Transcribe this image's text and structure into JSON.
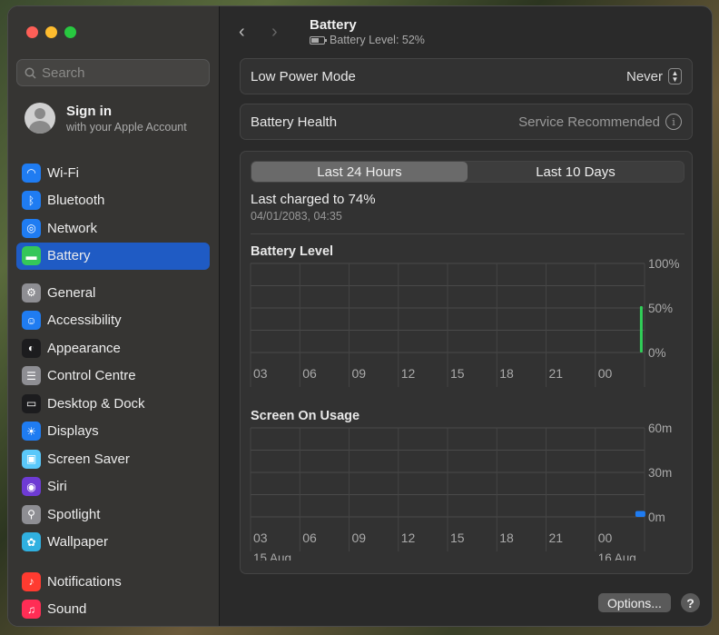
{
  "window": {
    "traffic": {
      "close": "#fe5f57",
      "minimize": "#febc2e",
      "zoom": "#28c840"
    }
  },
  "sidebar": {
    "search_placeholder": "Search",
    "account": {
      "title": "Sign in",
      "subtitle": "with your Apple Account"
    },
    "groups": [
      [
        {
          "label": "Wi-Fi",
          "icon": "wifi-icon",
          "color": "#1f7cf2"
        },
        {
          "label": "Bluetooth",
          "icon": "bluetooth-icon",
          "color": "#1f7cf2"
        },
        {
          "label": "Network",
          "icon": "globe-icon",
          "color": "#1f7cf2"
        },
        {
          "label": "Battery",
          "icon": "battery-icon",
          "color": "#34c759",
          "active": true
        }
      ],
      [
        {
          "label": "General",
          "icon": "gear-icon",
          "color": "#8e8e93"
        },
        {
          "label": "Accessibility",
          "icon": "accessibility-icon",
          "color": "#1f7cf2"
        },
        {
          "label": "Appearance",
          "icon": "appearance-icon",
          "color": "#1c1c1e"
        },
        {
          "label": "Control Centre",
          "icon": "control-centre-icon",
          "color": "#8e8e93"
        },
        {
          "label": "Desktop & Dock",
          "icon": "dock-icon",
          "color": "#1c1c1e"
        },
        {
          "label": "Displays",
          "icon": "sun-icon",
          "color": "#1f7cf2"
        },
        {
          "label": "Screen Saver",
          "icon": "screen-saver-icon",
          "color": "#5ac8fa"
        },
        {
          "label": "Siri",
          "icon": "siri-icon",
          "color": "#6e3bd4"
        },
        {
          "label": "Spotlight",
          "icon": "magnifier-icon",
          "color": "#8e8e93"
        },
        {
          "label": "Wallpaper",
          "icon": "wallpaper-icon",
          "color": "#30b0e0"
        }
      ],
      [
        {
          "label": "Notifications",
          "icon": "bell-icon",
          "color": "#ff3b30"
        },
        {
          "label": "Sound",
          "icon": "speaker-icon",
          "color": "#ff2d55"
        }
      ]
    ]
  },
  "header": {
    "title": "Battery",
    "subtitle": "Battery Level: 52%",
    "level": 0.52
  },
  "low_power": {
    "label": "Low Power Mode",
    "value": "Never"
  },
  "health": {
    "label": "Battery Health",
    "value": "Service Recommended"
  },
  "usage": {
    "tabs": [
      "Last 24 Hours",
      "Last 10 Days"
    ],
    "selected_tab": 0,
    "charged": "Last charged to 74%",
    "charged_date": "04/01/2083, 04:35"
  },
  "chart_data": [
    {
      "type": "bar",
      "title": "Battery Level",
      "x_ticks": [
        "03",
        "06",
        "09",
        "12",
        "15",
        "18",
        "21",
        "00"
      ],
      "y_ticks": [
        "100%",
        "50%",
        "0%"
      ],
      "ylim": [
        0,
        100
      ],
      "bars": [
        {
          "hour_offset": 23.8,
          "value": 52
        }
      ],
      "color": "#30d158"
    },
    {
      "type": "bar",
      "title": "Screen On Usage",
      "x_ticks": [
        "03",
        "06",
        "09",
        "12",
        "15",
        "18",
        "21",
        "00"
      ],
      "y_ticks": [
        "60m",
        "30m",
        "0m"
      ],
      "date_labels": [
        "15 Aug",
        "16 Aug"
      ],
      "ylim": [
        0,
        60
      ],
      "bars": [
        {
          "hour_offset": 23.8,
          "value": 4
        }
      ],
      "color": "#1f7cf2"
    }
  ],
  "footer": {
    "options_label": "Options...",
    "help_label": "?"
  }
}
